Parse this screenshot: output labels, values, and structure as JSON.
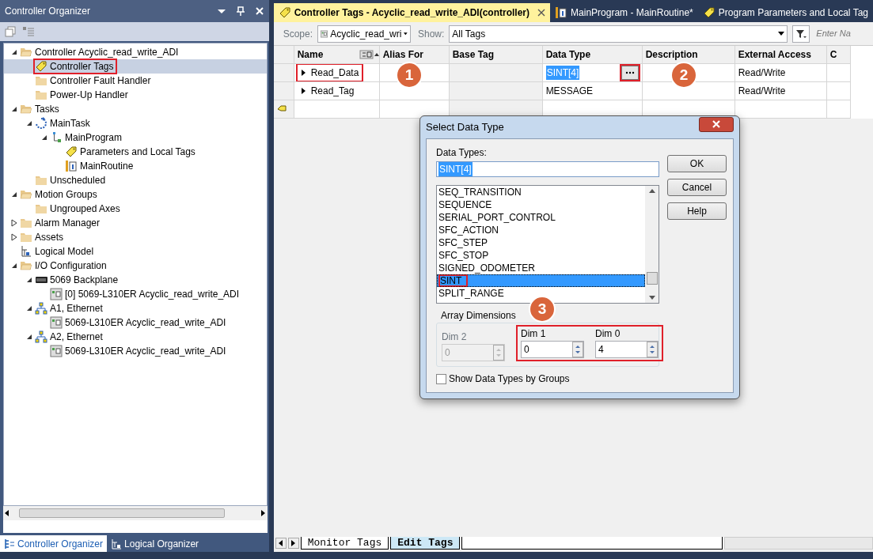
{
  "organizer": {
    "title": "Controller Organizer",
    "tree": [
      {
        "label": "Controller Acyclic_read_write_ADI",
        "kind": "folder-open",
        "expanded": true,
        "selected": false,
        "children": [
          {
            "label": "Controller Tags",
            "kind": "tag",
            "selected": true,
            "highlighted": true
          },
          {
            "label": "Controller Fault Handler",
            "kind": "folder",
            "selected": false
          },
          {
            "label": "Power-Up Handler",
            "kind": "folder",
            "selected": false
          }
        ]
      },
      {
        "label": "Tasks",
        "kind": "folder-open",
        "expanded": true,
        "selected": false,
        "children": [
          {
            "label": "MainTask",
            "kind": "task",
            "expanded": true,
            "selected": false,
            "children": [
              {
                "label": "MainProgram",
                "kind": "program",
                "expanded": true,
                "selected": false,
                "children": [
                  {
                    "label": "Parameters and Local Tags",
                    "kind": "tag",
                    "selected": false
                  },
                  {
                    "label": "MainRoutine",
                    "kind": "routine",
                    "selected": false
                  }
                ]
              }
            ]
          },
          {
            "label": "Unscheduled",
            "kind": "folder",
            "selected": false
          }
        ]
      },
      {
        "label": "Motion Groups",
        "kind": "folder-open",
        "expanded": true,
        "selected": false,
        "children": [
          {
            "label": "Ungrouped Axes",
            "kind": "folder",
            "selected": false
          }
        ]
      },
      {
        "label": "Alarm Manager",
        "kind": "folder",
        "expanded": false,
        "selected": false
      },
      {
        "label": "Assets",
        "kind": "folder",
        "expanded": false,
        "selected": false
      },
      {
        "label": "Logical Model",
        "kind": "model",
        "selected": false
      },
      {
        "label": "I/O Configuration",
        "kind": "folder-open",
        "expanded": true,
        "selected": false,
        "children": [
          {
            "label": "5069 Backplane",
            "kind": "backplane",
            "expanded": true,
            "selected": false,
            "children": [
              {
                "label": "[0] 5069-L310ER Acyclic_read_write_ADI",
                "kind": "module",
                "selected": false
              }
            ]
          },
          {
            "label": "A1, Ethernet",
            "kind": "network",
            "expanded": true,
            "selected": false,
            "children": [
              {
                "label": "5069-L310ER Acyclic_read_write_ADI",
                "kind": "module",
                "selected": false
              }
            ]
          },
          {
            "label": "A2, Ethernet",
            "kind": "network",
            "expanded": true,
            "selected": false,
            "children": [
              {
                "label": "5069-L310ER Acyclic_read_write_ADI",
                "kind": "module",
                "selected": false
              }
            ]
          }
        ]
      }
    ],
    "bottom_tabs": [
      {
        "label": "Controller Organizer",
        "selected": true
      },
      {
        "label": "Logical Organizer",
        "selected": false
      }
    ]
  },
  "editor_tabs": [
    {
      "label": "Controller Tags - Acyclic_read_write_ADI(controller)",
      "kind": "tag",
      "selected": true
    },
    {
      "label": "MainProgram - MainRoutine*",
      "kind": "routine",
      "selected": false
    },
    {
      "label": "Program Parameters and Local Tag",
      "kind": "tag",
      "selected": false
    }
  ],
  "toolbar": {
    "scope_label": "Scope:",
    "scope_value": "Acyclic_read_wri",
    "show_label": "Show:",
    "show_value": "All Tags",
    "filter_placeholder": "Enter Na"
  },
  "table": {
    "columns": [
      "Name",
      "Alias For",
      "Base Tag",
      "Data Type",
      "Description",
      "External Access",
      "C"
    ],
    "rows": [
      {
        "name": "Read_Data",
        "alias_for": "",
        "data_type": "SINT[4]",
        "external_access": "Read/Write",
        "selected": true,
        "highlighted": true
      },
      {
        "name": "Read_Tag",
        "alias_for": "",
        "data_type": "MESSAGE",
        "external_access": "Read/Write",
        "selected": false,
        "highlighted": false
      }
    ]
  },
  "callouts": [
    "1",
    "2",
    "3"
  ],
  "dialog": {
    "title": "Select Data Type",
    "field_label": "Data Types:",
    "field_value": "SINT[4]",
    "items": [
      {
        "label": "SEQ_TRANSITION",
        "selected": false
      },
      {
        "label": "SEQUENCE",
        "selected": false
      },
      {
        "label": "SERIAL_PORT_CONTROL",
        "selected": false
      },
      {
        "label": "SFC_ACTION",
        "selected": false
      },
      {
        "label": "SFC_STEP",
        "selected": false
      },
      {
        "label": "SFC_STOP",
        "selected": false
      },
      {
        "label": "SIGNED_ODOMETER",
        "selected": false
      },
      {
        "label": "SINT",
        "selected": true,
        "highlighted": true
      },
      {
        "label": "SPLIT_RANGE",
        "selected": false
      }
    ],
    "buttons": [
      "OK",
      "Cancel",
      "Help"
    ],
    "dims_label": "Array Dimensions",
    "dims": [
      {
        "label": "Dim 2",
        "value": "0",
        "disabled": true
      },
      {
        "label": "Dim 1",
        "value": "0",
        "disabled": false
      },
      {
        "label": "Dim 0",
        "value": "4",
        "disabled": false
      }
    ],
    "checkbox": {
      "label": "Show Data Types by Groups",
      "checked": false
    }
  },
  "sheet_tabs": [
    {
      "label": "Monitor Tags",
      "selected": false
    },
    {
      "label": "Edit Tags",
      "selected": true
    }
  ]
}
